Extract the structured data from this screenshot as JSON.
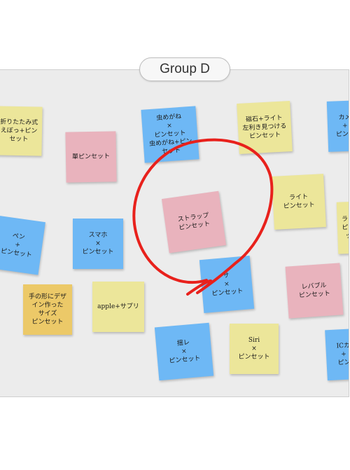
{
  "group": {
    "label": "Group D"
  },
  "colors": {
    "yellow": "#ece69a",
    "pink": "#e9b3bd",
    "blue": "#6eb8f5",
    "orange": "#ecc968",
    "circle": "#e8211c"
  },
  "notes": [
    {
      "text": "折りたたみ式\nえぼっ+ピンセット"
    },
    {
      "text": "單ピンセット"
    },
    {
      "text": "虫めがね\n×\nピンセット\n虫めがね+ピンセット"
    },
    {
      "text": "磁石+ライト\n左利き見つける\nピンセット"
    },
    {
      "text": "カメ\n+\nピンセ"
    },
    {
      "text": "ストラップ\nピンセット"
    },
    {
      "text": "ライト\nピンセット"
    },
    {
      "text": "ペン\n+\nピンセット"
    },
    {
      "text": "スマホ\n×\nピンセット"
    },
    {
      "text": "サ\n×\nピンセット"
    },
    {
      "text": "レバブル\nピンセット"
    },
    {
      "text": "手の形にデザイン作った\nサイズ\nピンセット"
    },
    {
      "text": "apple+サプリ"
    },
    {
      "text": "Siri\n×\nピンセット"
    },
    {
      "text": "揺レ\n×\nピンセット"
    },
    {
      "text": "ICカ\n+\nピン"
    }
  ]
}
